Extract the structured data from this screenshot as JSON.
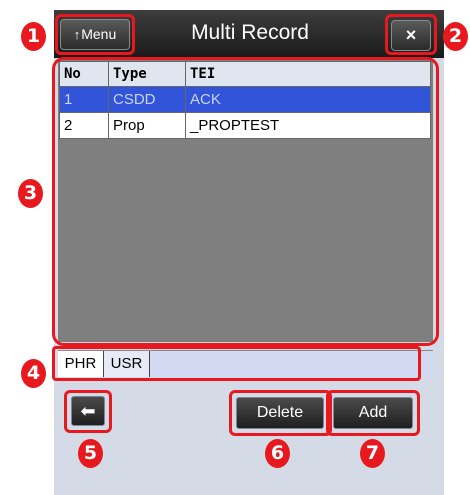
{
  "header": {
    "title": "Multi Record",
    "menu_label": "Menu",
    "menu_icon": "↑",
    "close_icon": "×"
  },
  "table": {
    "columns": [
      "No",
      "Type",
      "TEI"
    ],
    "rows": [
      {
        "no": "1",
        "type": "CSDD",
        "tei": "ACK",
        "selected": true
      },
      {
        "no": "2",
        "type": "Prop",
        "tei": "_PROPTEST",
        "selected": false
      }
    ]
  },
  "tabs": [
    {
      "label": "PHR",
      "active": true
    },
    {
      "label": "USR",
      "active": false
    }
  ],
  "footer": {
    "back_icon": "⬅",
    "delete_label": "Delete",
    "add_label": "Add"
  },
  "callouts": [
    "1",
    "2",
    "3",
    "4",
    "5",
    "6",
    "7"
  ],
  "colors": {
    "callout": "#e8191e",
    "selected_row": "#3154d8",
    "titlebar": "#2a2a2a"
  }
}
